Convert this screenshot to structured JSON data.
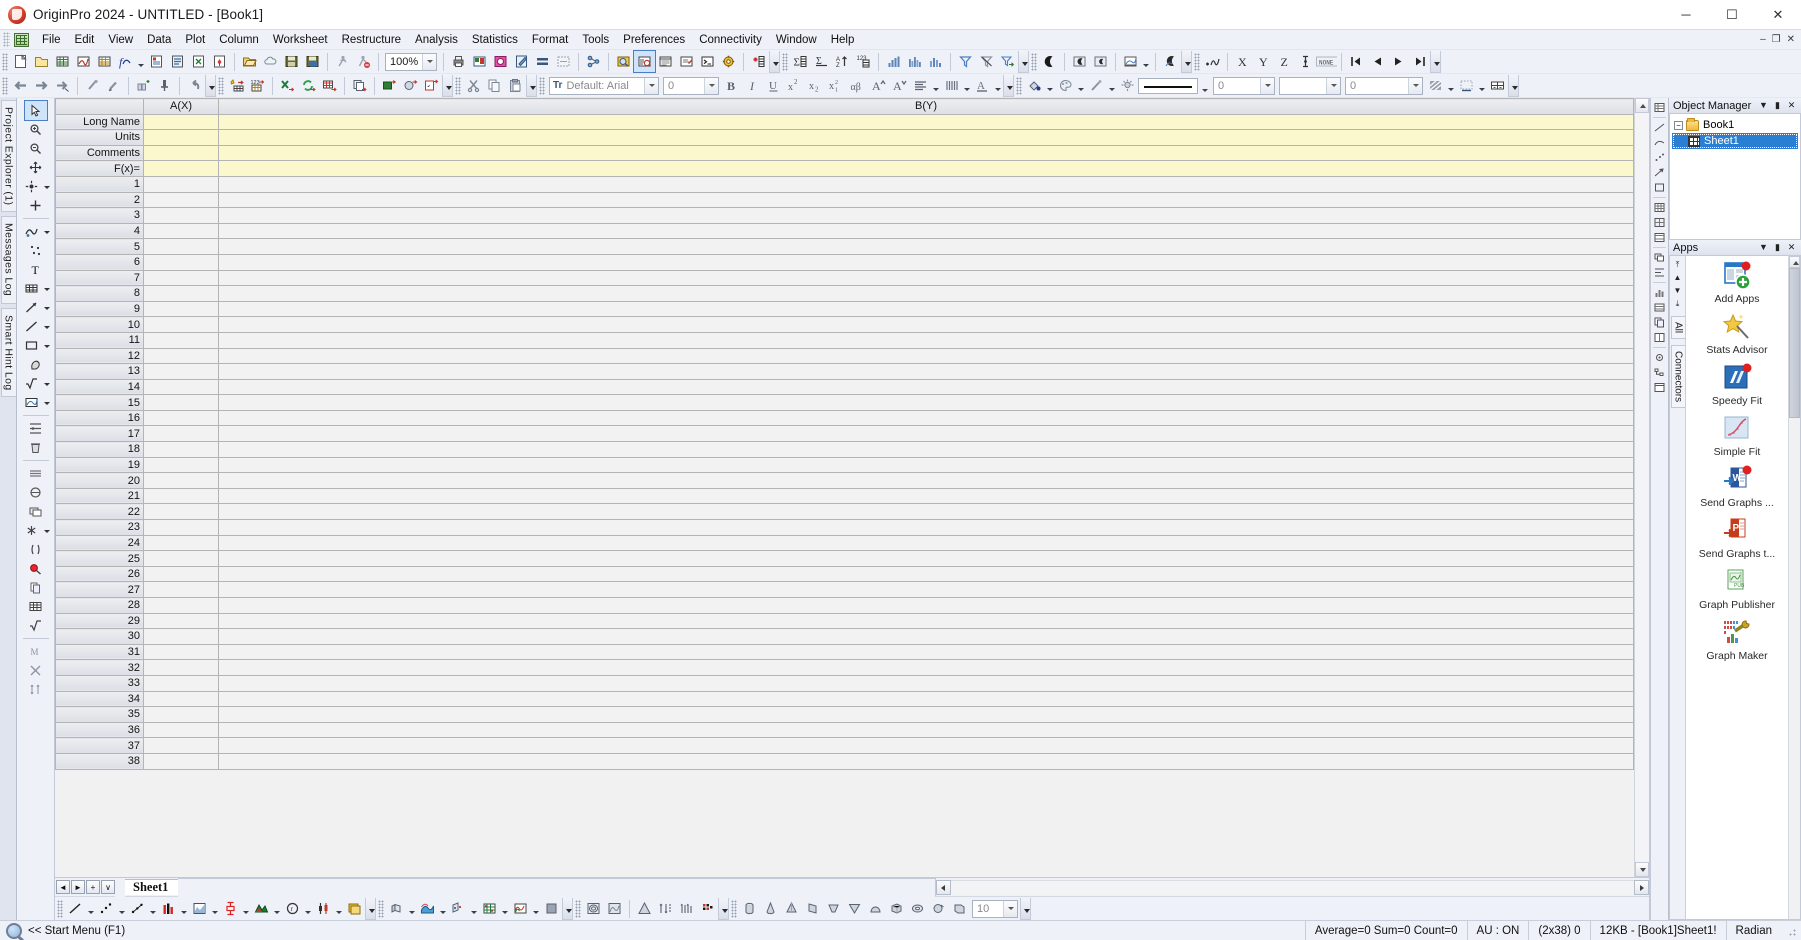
{
  "window": {
    "title": "OriginPro 2024 - UNTITLED - [Book1]",
    "app_icon": "origin-logo-icon",
    "minimize": "─",
    "maximize": "☐",
    "close": "✕",
    "mdi_minimize": "–",
    "mdi_restore": "❐",
    "mdi_close": "✕"
  },
  "menu": {
    "items": [
      {
        "label": "File",
        "key": "F"
      },
      {
        "label": "Edit",
        "key": "E"
      },
      {
        "label": "View",
        "key": "V"
      },
      {
        "label": "Data",
        "key": "D"
      },
      {
        "label": "Plot",
        "key": "P"
      },
      {
        "label": "Column",
        "key": "C"
      },
      {
        "label": "Worksheet",
        "key": "k"
      },
      {
        "label": "Restructure",
        "key": "u"
      },
      {
        "label": "Analysis",
        "key": "A"
      },
      {
        "label": "Statistics",
        "key": "S"
      },
      {
        "label": "Format",
        "key": "o"
      },
      {
        "label": "Tools",
        "key": "T"
      },
      {
        "label": "Preferences",
        "key": "r"
      },
      {
        "label": "Connectivity",
        "key": "n"
      },
      {
        "label": "Window",
        "key": "W"
      },
      {
        "label": "Help",
        "key": "H"
      }
    ]
  },
  "toolbar": {
    "zoom_value": "100%",
    "font_value": "Default: Arial",
    "font_size_value": "0",
    "line_width_value": "0",
    "pattern_width_value": "0",
    "fill_value": "",
    "standard_icons": [
      "new-project-icon",
      "new-folder-icon",
      "new-workbook-icon",
      "new-graph-icon",
      "new-matrix-icon",
      "new-function-plot-icon",
      "new-notes-icon",
      "new-layout-icon",
      "new-excel-icon",
      "new-template-icon"
    ],
    "file_icons": [
      "open-icon",
      "open-cloud-icon",
      "save-project-icon",
      "save-template-icon"
    ],
    "run_icons": [
      "run-script-icon",
      "stop-script-icon"
    ],
    "view_icons": [
      "print-icon",
      "print-preview-icon",
      "image-export-icon",
      "edit-icon",
      "duplicate-icon",
      "resize-icon"
    ],
    "tree_icons": [
      "project-explorer-icon",
      "results-log-icon",
      "command-window-icon",
      "script-window-icon",
      "code-builder-icon",
      "console-icon",
      "app-center-icon"
    ],
    "data_icons": [
      "add-new-column-icon",
      "statistics-icon",
      "sum-icon",
      "sort-icon",
      "normalize-icon",
      "histogram-icon",
      "column-chart-icon",
      "bar-chart-icon"
    ],
    "filter_icons": [
      "filter-icon",
      "clear-filter-icon",
      "filter-export-icon"
    ],
    "mask_icons": [
      "mask-icon",
      "mask-range-icon",
      "unmask-icon",
      "mask-chart-icon"
    ],
    "axis_icons": [
      "x-axis-icon",
      "y-axis-icon",
      "z-axis-icon",
      "error-bar-icon",
      "none-label-icon"
    ],
    "nav_icons": [
      "first-icon",
      "previous-icon",
      "next-icon",
      "last-icon"
    ],
    "format_icons": [
      "bold",
      "italic",
      "underline",
      "superscript",
      "subscript",
      "super-subscript",
      "greek",
      "increase-font",
      "decrease-font",
      "align",
      "line-style",
      "font-color"
    ],
    "style_icons": [
      "fill-color-icon",
      "palette-icon",
      "line-color-icon",
      "lighting-icon"
    ]
  },
  "left_rail": {
    "tabs": [
      {
        "label": "Project Explorer (1)",
        "name": "project-explorer"
      },
      {
        "label": "Messages Log",
        "name": "messages-log"
      },
      {
        "label": "Smart Hint Log",
        "name": "smart-hint-log"
      }
    ]
  },
  "worksheet": {
    "corner_label": "",
    "columns": [
      {
        "label": "A(X)",
        "name": "column-a"
      },
      {
        "label": "B(Y)",
        "name": "column-b"
      }
    ],
    "header_rows": [
      {
        "label": "Long Name"
      },
      {
        "label": "Units"
      },
      {
        "label": "Comments"
      },
      {
        "label": "F(x)="
      }
    ],
    "data_rows": [
      "1",
      "2",
      "3",
      "4",
      "5",
      "6",
      "7",
      "8",
      "9",
      "10",
      "11",
      "12",
      "13",
      "14",
      "15",
      "16",
      "17",
      "18",
      "19",
      "20",
      "21",
      "22",
      "23",
      "24",
      "25",
      "26",
      "27",
      "28",
      "29",
      "30",
      "31",
      "32",
      "33",
      "34",
      "35",
      "36",
      "37",
      "38"
    ],
    "sheet_tab": "Sheet1",
    "tab_nav": [
      {
        "label": "◄",
        "name": "tab-prev"
      },
      {
        "label": "►",
        "name": "tab-next"
      },
      {
        "label": "+",
        "name": "tab-add"
      },
      {
        "label": "∨",
        "name": "tab-list"
      }
    ]
  },
  "object_manager": {
    "title": "Object Manager",
    "collapse_glyph": "▼",
    "pin_glyph": "▮",
    "close_glyph": "✕",
    "expander": "−",
    "nodes": [
      {
        "label": "Book1",
        "icon": "folder-icon",
        "selected": false
      },
      {
        "label": "Sheet1",
        "icon": "worksheet-grid-icon",
        "selected": true
      }
    ]
  },
  "apps_panel": {
    "title": "Apps",
    "collapse_glyph": "▼",
    "pin_glyph": "▮",
    "close_glyph": "✕",
    "scroll_buttons": [
      "⤒",
      "▲",
      "▼",
      "⤓"
    ],
    "vertical_tabs": [
      {
        "label": "All",
        "name": "apps-tab-all"
      },
      {
        "label": "Connectors",
        "name": "apps-tab-connectors"
      }
    ],
    "items": [
      {
        "label": "Add Apps",
        "icon": "add-apps-icon"
      },
      {
        "label": "Stats Advisor",
        "icon": "stats-advisor-icon"
      },
      {
        "label": "Speedy Fit",
        "icon": "speedy-fit-icon"
      },
      {
        "label": "Simple Fit",
        "icon": "simple-fit-icon"
      },
      {
        "label": "Send Graphs ...",
        "icon": "send-graphs-word-icon"
      },
      {
        "label": "Send Graphs t...",
        "icon": "send-graphs-powerpoint-icon"
      },
      {
        "label": "Graph Publisher",
        "icon": "graph-publisher-icon"
      },
      {
        "label": "Graph Maker",
        "icon": "graph-maker-icon"
      }
    ]
  },
  "bottom_toolbar": {
    "plot_types": [
      "line-plot-icon",
      "scatter-plot-icon",
      "line-symbol-icon",
      "column-plot-icon",
      "area-plot-icon",
      "box-plot-icon",
      "fill-area-icon",
      "polar-plot-icon",
      "candlestick-icon",
      "image-plot-icon"
    ],
    "three_d_types": [
      "3d-bar-icon",
      "3d-surface-icon",
      "3d-scatter-icon",
      "3d-wire-icon",
      "3d-waterfall-icon",
      "3d-wall-icon"
    ],
    "speciality": [
      "contour-icon",
      "heatmap-icon",
      "ternary-icon",
      "vector-xy-icon",
      "vector-angle-icon",
      "pixel-icon"
    ],
    "objects": [
      "cylinder-icon",
      "cone-icon",
      "pyramid-icon",
      "prism-icon",
      "torus-icon",
      "sphere-icon",
      "cube-icon",
      "box-icon"
    ],
    "count_value": "10"
  },
  "status_bar": {
    "start_menu": "<< Start Menu (F1)",
    "magnifier_icon": "magnifier-icon",
    "cells": [
      {
        "label": "Average=0 Sum=0 Count=0",
        "name": "stats-readout"
      },
      {
        "label": "AU : ON",
        "name": "auto-update-status"
      },
      {
        "label": "(2x38) 0",
        "name": "selection-dimensions"
      },
      {
        "label": "12KB - [Book1]Sheet1!",
        "name": "memory-and-location"
      },
      {
        "label": "Radian",
        "name": "angle-unit"
      }
    ]
  }
}
